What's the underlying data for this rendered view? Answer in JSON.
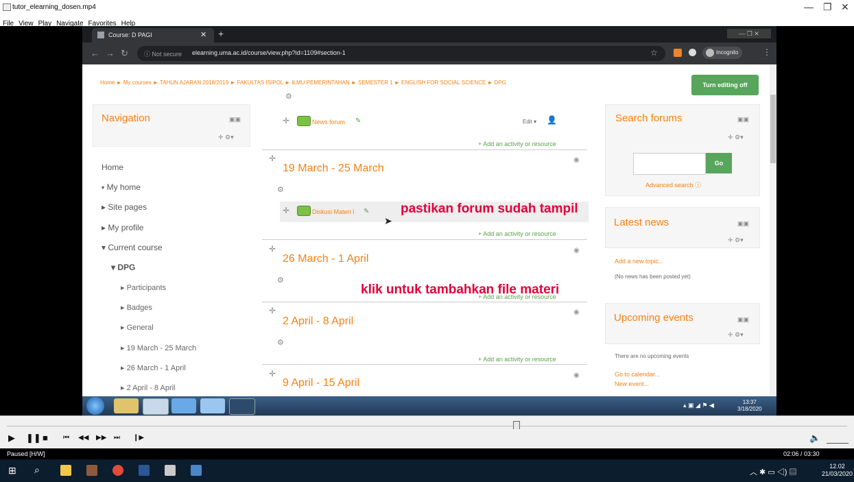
{
  "player": {
    "title": "tutor_elearning_dosen.mp4",
    "menu": [
      "File",
      "View",
      "Play",
      "Navigate",
      "Favorites",
      "Help"
    ],
    "status": "Paused [H/W]",
    "time": "02:06 / 03:30",
    "seek_progress": 0.6
  },
  "browser": {
    "tab_title": "Course: D PAGI",
    "security": "Not secure",
    "url": "elearning.uma.ac.id/course/view.php?id=1109#section-1",
    "incognito_label": "Incognito",
    "new_tab": "+"
  },
  "moodle": {
    "breadcrumb": "Home ► My courses ► TAHUN AJARAN 2018/2019 ► FAKULTAS ISIPOL ► ILMU PEMERINTAHAN ► SEMESTER 1 ► ENGLISH FOR SOCIAL SCIENCE ► DPG",
    "edit_button": "Turn editing off",
    "navigation": {
      "title": "Navigation",
      "home": "Home",
      "my_home": "My home",
      "site_pages": "Site pages",
      "my_profile": "My profile",
      "current_course": "Current course",
      "course": "DPG",
      "participants": "Participants",
      "badges": "Badges",
      "general": "General",
      "week1": "19 March - 25 March",
      "week2": "26 March - 1 April",
      "week3": "2 April - 8 April"
    },
    "center": {
      "news_forum": "News forum",
      "edit_menu": "Edit ▾",
      "add_activity": "+ Add an activity or resource",
      "section1": "19 March - 25 March",
      "diskusi": "Diskusi Materi I",
      "section2": "26 March - 1 April",
      "section3": "2 April - 8 April",
      "section4": "9 April - 15 April"
    },
    "search_forums": {
      "title": "Search forums",
      "go": "Go",
      "advanced": "Advanced search"
    },
    "latest_news": {
      "title": "Latest news",
      "add_topic": "Add a new topic...",
      "none": "(No news has been posted yet)"
    },
    "upcoming": {
      "title": "Upcoming events",
      "none": "There are no upcoming events",
      "calendar": "Go to calendar...",
      "new_event": "New event..."
    }
  },
  "annotations": {
    "a1": "pastikan forum sudah tampil",
    "a2": "klik untuk tambahkan file materi"
  },
  "vm_clock": {
    "time": "13:37",
    "date": "3/18/2020"
  },
  "win_clock": {
    "time": "12.02",
    "date": "21/03/2020"
  },
  "colors": {
    "accent": "#f98012",
    "button_green": "#58a55c",
    "annotation_red": "#e4003a"
  }
}
